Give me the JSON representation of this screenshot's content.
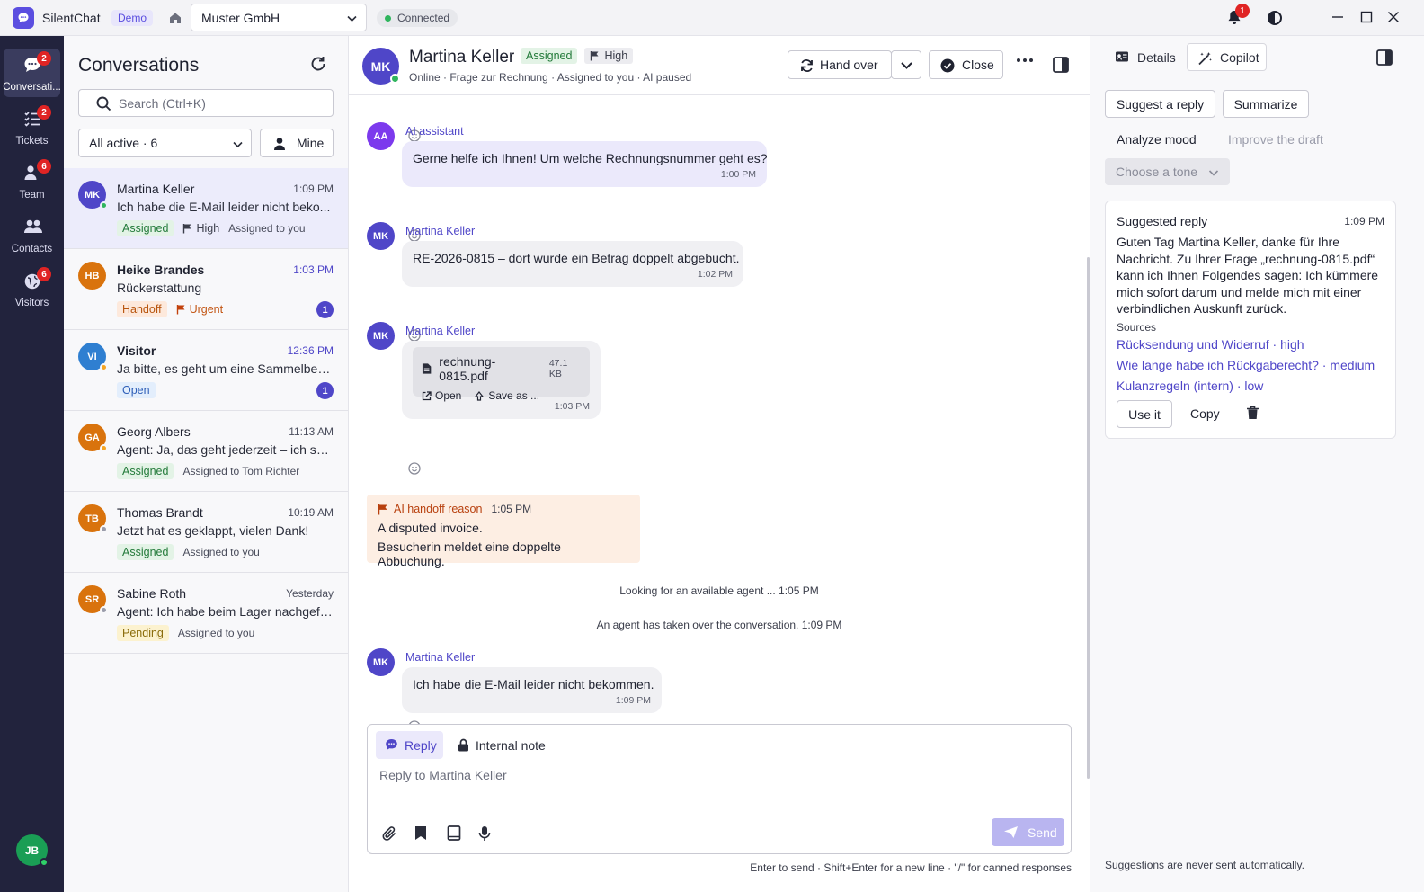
{
  "app": {
    "name": "SilentChat",
    "badge": "Demo",
    "workspace": "Muster GmbH",
    "connection": "Connected",
    "notifications": "1",
    "accent": "#5b4ee0"
  },
  "rail": {
    "items": [
      {
        "label": "Conversati...",
        "badge": "2"
      },
      {
        "label": "Tickets",
        "badge": "2"
      },
      {
        "label": "Team",
        "badge": "6"
      },
      {
        "label": "Contacts",
        "badge": ""
      },
      {
        "label": "Visitors",
        "badge": "6"
      }
    ],
    "user_initials": "JB"
  },
  "conversations": {
    "title": "Conversations",
    "search_placeholder": "Search (Ctrl+K)",
    "filter": "All active · 6",
    "mine_label": "Mine",
    "items": [
      {
        "initials": "MK",
        "name": "Martina Keller",
        "time": "1:09 PM",
        "preview": "Ich habe die E-Mail leider nicht beko...",
        "status_tag": "Assigned",
        "priority": "High",
        "assignee": "Assigned to you",
        "unread": "",
        "avatar_color": "#4f46c8",
        "presence": "#2fb55d"
      },
      {
        "initials": "HB",
        "name": "Heike Brandes",
        "time": "1:03 PM",
        "preview": "Rückerstattung",
        "status_tag": "Handoff",
        "priority": "Urgent",
        "assignee": "",
        "unread": "1",
        "avatar_color": "#d9730d",
        "presence": ""
      },
      {
        "initials": "VI",
        "name": "Visitor",
        "time": "12:36 PM",
        "preview": "Ja bitte, es geht um eine Sammelbest...",
        "status_tag": "Open",
        "priority": "",
        "assignee": "",
        "unread": "1",
        "avatar_color": "#2f7fd1",
        "presence": "#f5a524"
      },
      {
        "initials": "GA",
        "name": "Georg Albers",
        "time": "11:13 AM",
        "preview": "Agent: Ja, das geht jederzeit – ich sch...",
        "status_tag": "Assigned",
        "priority": "",
        "assignee": "Assigned to Tom Richter",
        "unread": "",
        "avatar_color": "#d9730d",
        "presence": "#f5a524"
      },
      {
        "initials": "TB",
        "name": "Thomas Brandt",
        "time": "10:19 AM",
        "preview": "Jetzt hat es geklappt, vielen Dank!",
        "status_tag": "Assigned",
        "priority": "",
        "assignee": "Assigned to you",
        "unread": "",
        "avatar_color": "#d9730d",
        "presence": "#9a9caa"
      },
      {
        "initials": "SR",
        "name": "Sabine Roth",
        "time": "Yesterday",
        "preview": "Agent: Ich habe beim Lager nachgefr...",
        "status_tag": "Pending",
        "priority": "",
        "assignee": "Assigned to you",
        "unread": "",
        "avatar_color": "#d9730d",
        "presence": "#9a9caa"
      }
    ]
  },
  "chat": {
    "initials": "MK",
    "name": "Martina Keller",
    "status_tag": "Assigned",
    "priority": "High",
    "subtitle": "Online · Frage zur Rechnung · Assigned to you · AI paused",
    "hand_over": "Hand over",
    "close": "Close",
    "messages": [
      {
        "initials": "AA",
        "author": "AI assistant",
        "text": "Gerne helfe ich Ihnen! Um welche Rechnungsnummer geht es?",
        "time": "1:00 PM"
      },
      {
        "initials": "MK",
        "author": "Martina Keller",
        "text": "RE-2026-0815 – dort wurde ein Betrag doppelt abgebucht.",
        "time": "1:02 PM"
      },
      {
        "initials": "MK",
        "author": "Martina Keller",
        "file": {
          "name": "rechnung-0815.pdf",
          "size": "47.1 KB",
          "open": "Open",
          "save": "Save as ..."
        },
        "time": "1:03 PM"
      },
      {
        "initials": "MK",
        "author": "Martina Keller",
        "text": "Ich habe die E-Mail leider nicht bekommen.",
        "time": "1:09 PM"
      }
    ],
    "handoff": {
      "title": "AI handoff reason",
      "time": "1:05 PM",
      "line1": "A disputed invoice.",
      "line2": "Besucherin meldet eine doppelte Abbuchung."
    },
    "system": [
      {
        "text": "Looking for an available agent ...",
        "time": "1:05 PM"
      },
      {
        "text": "An agent has taken over the conversation.",
        "time": "1:09 PM"
      }
    ],
    "composer": {
      "tab_reply": "Reply",
      "tab_note": "Internal note",
      "placeholder": "Reply to Martina Keller",
      "send": "Send"
    },
    "hint": "Enter to send · Shift+Enter for a new line · \"/\" for canned responses"
  },
  "copilot": {
    "tabs": [
      "Details",
      "Copilot"
    ],
    "actions": [
      "Suggest a reply",
      "Summarize",
      "Analyze mood",
      "Improve the draft"
    ],
    "tone": "Choose a tone",
    "suggestion": {
      "title": "Suggested reply",
      "time": "1:09 PM",
      "body": "Guten Tag Martina Keller, danke für Ihre Nachricht. Zu Ihrer Frage „rechnung-0815.pdf“ kann ich Ihnen Folgendes sagen: Ich kümmere mich sofort darum und melde mich mit einer verbindlichen Auskunft zurück.",
      "sources_label": "Sources",
      "sources": [
        "Rücksendung und Widerruf · high",
        "Wie lange habe ich Rückgaberecht? · medium",
        "Kulanzregeln (intern) · low"
      ],
      "use_it": "Use it",
      "copy": "Copy"
    },
    "footer": "Suggestions are never sent automatically."
  }
}
